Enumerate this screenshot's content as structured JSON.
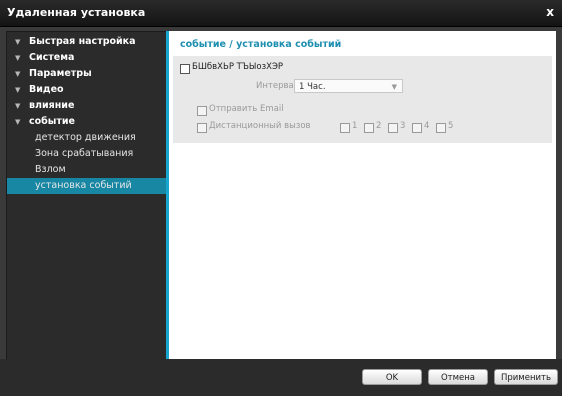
{
  "window": {
    "title": "Удаленная установка",
    "close_label": "x"
  },
  "sidebar": {
    "items": [
      {
        "label": "Быстрая настройка",
        "level": "main"
      },
      {
        "label": "Система",
        "level": "main"
      },
      {
        "label": "Параметры",
        "level": "main"
      },
      {
        "label": "Видео",
        "level": "main"
      },
      {
        "label": "влияние",
        "level": "main"
      },
      {
        "label": "событие",
        "level": "main"
      },
      {
        "label": "детектор движения",
        "level": "sub"
      },
      {
        "label": "Зона срабатывания",
        "level": "sub"
      },
      {
        "label": "Взлом",
        "level": "sub"
      },
      {
        "label": "установка событий",
        "level": "sub",
        "active": true
      }
    ],
    "arrow_glyph": "▼"
  },
  "main": {
    "title": "событие / установка событий",
    "enable_checkbox_label": "БШбвХЬР ТЪЫозХЭР",
    "interval_label": "Интервал",
    "interval_value": "1 Час.",
    "send_email_label": "Отправить Email",
    "remote_call_label": "Дистанционный вызов",
    "remote_call_options": [
      "1",
      "2",
      "3",
      "4",
      "5"
    ]
  },
  "footer": {
    "ok_label": "OK",
    "cancel_label": "Отмена",
    "apply_label": "Применить"
  },
  "colors": {
    "accent": "#17a6cf",
    "active_item": "#1787a4",
    "section_title": "#1f8fb0"
  }
}
